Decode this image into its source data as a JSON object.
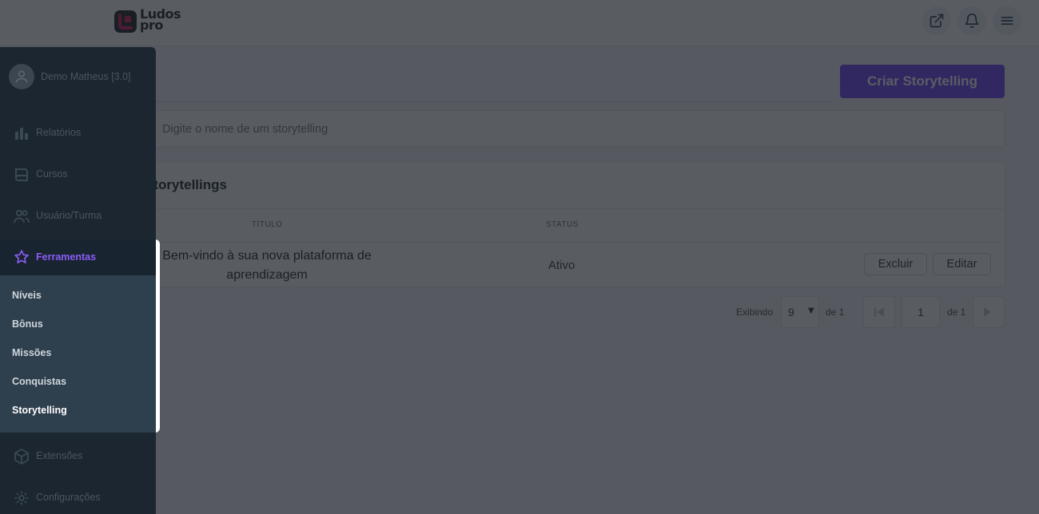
{
  "brand": {
    "logo_line1": "Ludos",
    "logo_line2": "pro",
    "accent": "#7b4dff"
  },
  "header": {
    "icons": [
      "external-link-icon",
      "bell-icon",
      "hamburger-menu-icon"
    ]
  },
  "sidebar": {
    "user": "Demo Matheus [3.0]",
    "items_top": [
      {
        "label": "Relatórios",
        "icon": "bar-chart-icon"
      },
      {
        "label": "Cursos",
        "icon": "book-icon"
      },
      {
        "label": "Usuário/Turma",
        "icon": "users-icon"
      }
    ],
    "active_section": {
      "label": "Ferramentas",
      "icon": "star-icon"
    },
    "sub_items": [
      "Níveis",
      "Bônus",
      "Missões",
      "Conquistas",
      "Storytelling"
    ],
    "active_sub_item": "Storytelling",
    "items_bottom": [
      {
        "label": "Extensões",
        "icon": "box-icon"
      },
      {
        "label": "Configurações",
        "icon": "gear-icon"
      }
    ]
  },
  "main": {
    "create_button": "Criar Storytelling",
    "search_placeholder": "Digite o nome de um storytelling",
    "card_title": "Storytellings",
    "columns": {
      "title": "TÍTULO",
      "status": "STATUS"
    },
    "rows": [
      {
        "title": "Bem-vindo à sua nova plataforma de aprendizagem",
        "status": "Ativo",
        "delete": "Excluir",
        "edit": "Editar"
      }
    ],
    "pager": {
      "showing_label": "Exibindo",
      "per_page": "9",
      "of_label_1": "de 1",
      "page": "1",
      "of_label_2": "de 1"
    }
  }
}
